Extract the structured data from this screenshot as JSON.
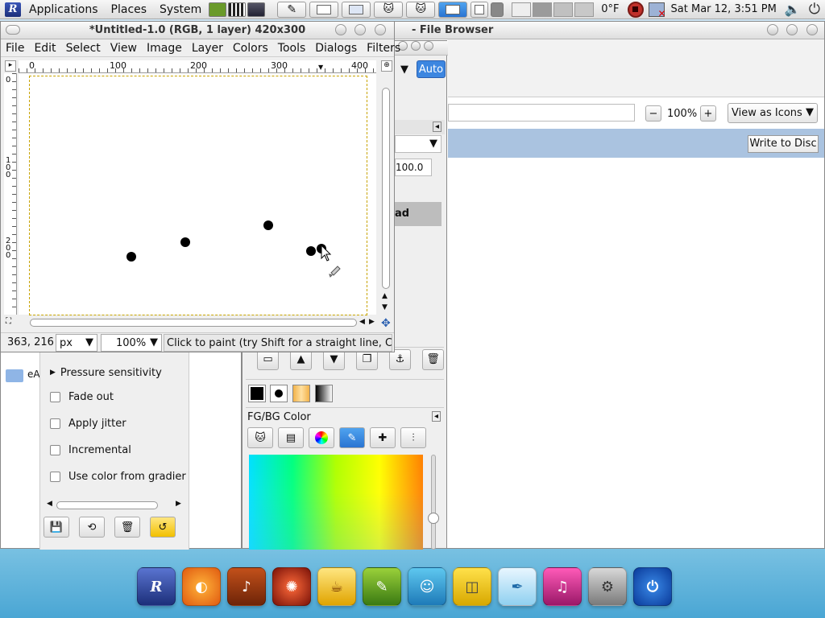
{
  "panel": {
    "menus": [
      "Applications",
      "Places",
      "System"
    ],
    "temperature": "0°F",
    "clock": "Sat Mar 12,  3:51 PM"
  },
  "gimp": {
    "title": "*Untitled-1.0 (RGB, 1 layer) 420x300",
    "menu": [
      "File",
      "Edit",
      "Select",
      "View",
      "Image",
      "Layer",
      "Colors",
      "Tools",
      "Dialogs",
      "Filters"
    ],
    "ruler_top": [
      "0",
      "100",
      "200",
      "300",
      "400"
    ],
    "ruler_left": [
      "0",
      "1 0 0",
      "2 0 0"
    ],
    "coords": "363, 216",
    "unit": "px",
    "zoom": "100%",
    "status": "Click to paint (try Shift for a straight line, C..."
  },
  "file_browser": {
    "title": "- File Browser",
    "zoom": "100%",
    "view_mode": "View as Icons",
    "write_label": "Write to Disc"
  },
  "toolbox": {
    "auto_label": "Auto",
    "opacity_value": "100.0",
    "mode_label": "ad"
  },
  "tool_options": {
    "side_label": "eA",
    "pressure": "Pressure sensitivity",
    "checks": [
      "Fade out",
      "Apply jitter",
      "Incremental",
      "Use color from gradier"
    ]
  },
  "fgbg": {
    "title": "FG/BG Color"
  }
}
